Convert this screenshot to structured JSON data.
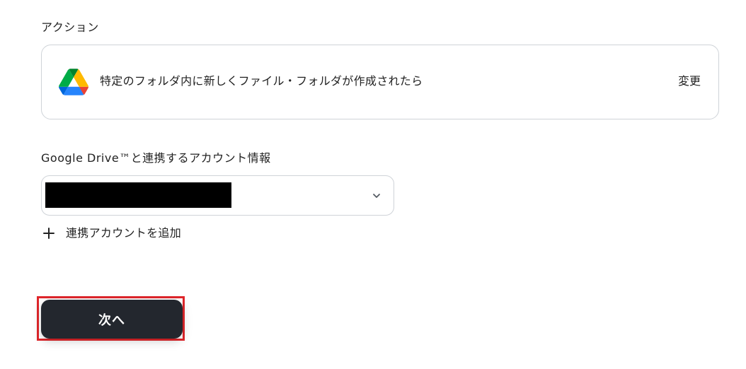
{
  "action_section": {
    "label": "アクション",
    "card": {
      "icon": "google-drive-icon",
      "text": "特定のフォルダ内に新しくファイル・フォルダが作成されたら",
      "change_label": "変更"
    }
  },
  "account_section": {
    "label": "Google Drive™と連携するアカウント情報",
    "selected_value": "",
    "add_account_label": "連携アカウントを追加",
    "add_icon": "plus-icon",
    "dropdown_icon": "chevron-down-icon"
  },
  "footer": {
    "next_label": "次へ"
  },
  "colors": {
    "primary_button": "#23272e",
    "highlight_border": "#e0262b",
    "card_border": "#cfd3d8",
    "redaction": "#000000"
  }
}
